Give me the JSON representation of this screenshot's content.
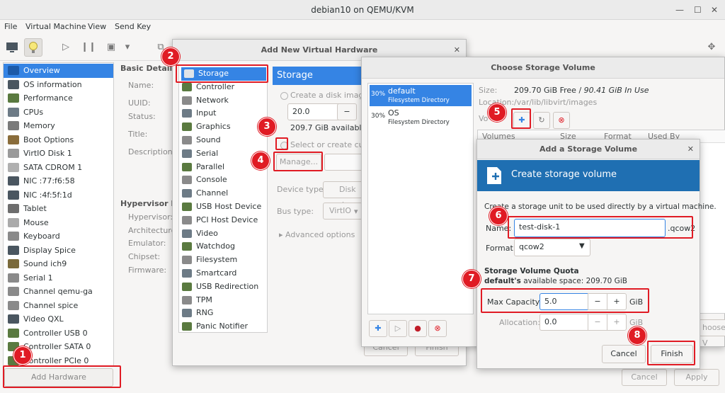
{
  "window": {
    "title": "debian10 on QEMU/KVM"
  },
  "menu": [
    "File",
    "Virtual Machine",
    "View",
    "Send Key"
  ],
  "sidebar": {
    "items": [
      "Overview",
      "OS information",
      "Performance",
      "CPUs",
      "Memory",
      "Boot Options",
      "VirtIO Disk 1",
      "SATA CDROM 1",
      "NIC :77:f6:58",
      "NIC :4f:5f:1d",
      "Tablet",
      "Mouse",
      "Keyboard",
      "Display Spice",
      "Sound ich9",
      "Serial 1",
      "Channel qemu-ga",
      "Channel spice",
      "Video QXL",
      "Controller USB 0",
      "Controller SATA 0",
      "Controller PCIe 0"
    ],
    "add_hardware": "Add Hardware"
  },
  "details": {
    "basic_heading": "Basic Details",
    "basic_labels": [
      "Name:",
      "UUID:",
      "Status:",
      "Title:",
      "Description:"
    ],
    "hypervisor_heading": "Hypervisor Det",
    "hypervisor_labels": [
      "Hypervisor:",
      "Architecture",
      "Emulator:",
      "Chipset:",
      "Firmware:"
    ]
  },
  "bottom_buttons": {
    "cancel": "Cancel",
    "apply": "Apply"
  },
  "add_hw": {
    "title": "Add New Virtual Hardware",
    "list": [
      "Storage",
      "Controller",
      "Network",
      "Input",
      "Graphics",
      "Sound",
      "Serial",
      "Parallel",
      "Console",
      "Channel",
      "USB Host Device",
      "PCI Host Device",
      "Video",
      "Watchdog",
      "Filesystem",
      "Smartcard",
      "USB Redirection",
      "TPM",
      "RNG",
      "Panic Notifier"
    ],
    "panel_title": "Storage",
    "create_disk": "Create a disk image f",
    "disk_size": "20.0",
    "minus": "−",
    "available": "209.7 GiB available in",
    "select_custom": "Select or create custo",
    "manage": "Manage...",
    "device_type_label": "Device type:",
    "device_type_value": "Disk de",
    "bus_type_label": "Bus type:",
    "bus_type_value": "VirtIO",
    "advanced": "Advanced options",
    "cancel": "Cancel",
    "finish": "Finish"
  },
  "choose_vol": {
    "title": "Choose Storage Volume",
    "pools": [
      {
        "pct": "30%",
        "name": "default",
        "sub": "Filesystem Directory"
      },
      {
        "pct": "30%",
        "name": "OS",
        "sub": "Filesystem Directory"
      }
    ],
    "size_label": "Size:",
    "size_free": "209.70 GiB Free / ",
    "size_use": "90.41 GiB In Use",
    "location_label": "Location:",
    "location_value": "/var/lib/libvirt/images",
    "volumes_label": "Vo",
    "columns": [
      "Volumes",
      "Size",
      "Format",
      "Used By"
    ],
    "choose_btn": "hoose V"
  },
  "add_vol": {
    "title": "Add a Storage Volume",
    "banner": "Create storage volume",
    "description": "Create a storage unit to be used directly by a virtual machine.",
    "name_label": "Name:",
    "name_value": "test-disk-1",
    "ext": ".qcow2",
    "format_label": "Format:",
    "format_value": "qcow2",
    "quota_heading": "Storage Volume Quota",
    "avail_pool": "default's",
    "avail_text": " available space: 209.70 GiB",
    "max_label": "Max Capacity:",
    "max_value": "5.0",
    "alloc_label": "Allocation:",
    "alloc_value": "0.0",
    "unit": "GiB",
    "minus": "−",
    "plus": "+",
    "cancel": "Cancel",
    "finish": "Finish"
  },
  "badges": [
    "1",
    "2",
    "3",
    "4",
    "5",
    "6",
    "7",
    "8"
  ]
}
